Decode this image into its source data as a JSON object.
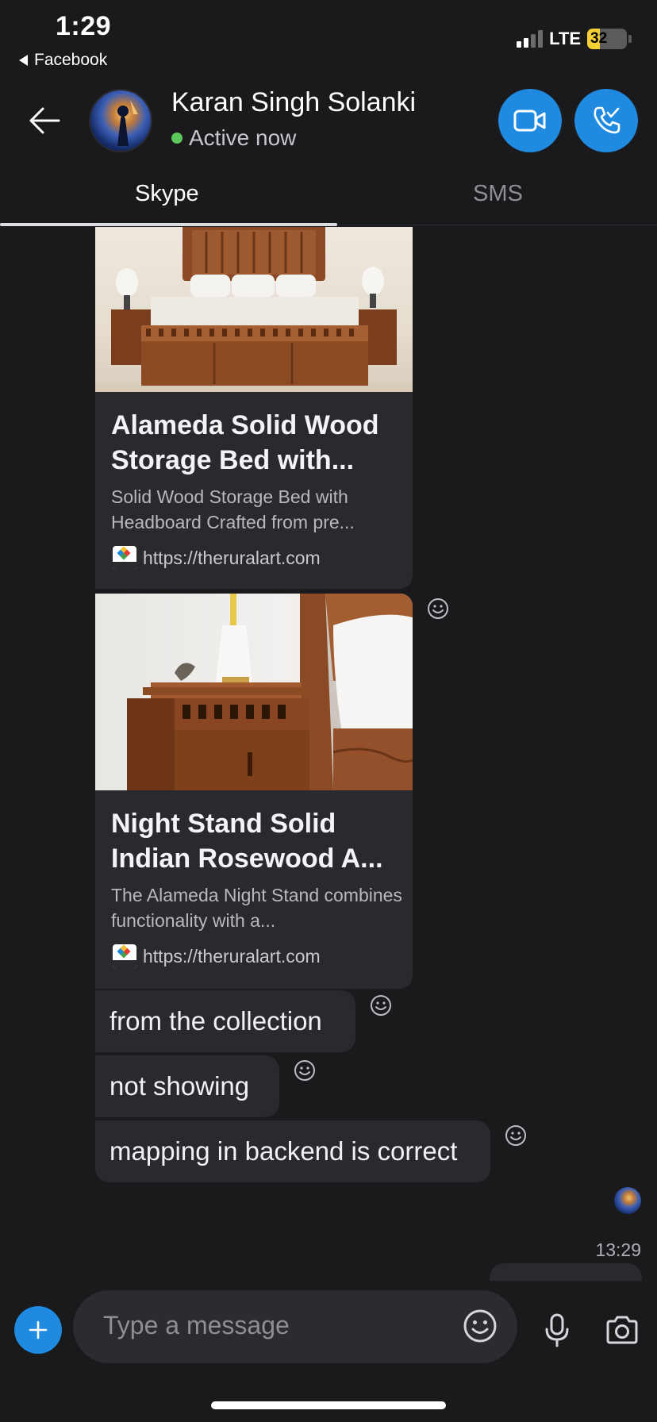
{
  "status_bar": {
    "time": "1:29",
    "back_app": "Facebook",
    "network": "LTE",
    "battery_percent": "32",
    "battery_level": 0.32
  },
  "header": {
    "contact_name": "Karan Singh Solanki",
    "presence": "Active now",
    "icons": {
      "back": "back-arrow-icon",
      "video_call": "video-camera-icon",
      "audio_call": "phone-call-icon"
    }
  },
  "tabs": [
    {
      "label": "Skype",
      "active": true
    },
    {
      "label": "SMS",
      "active": false
    }
  ],
  "messages": {
    "cards": [
      {
        "title": "Alameda Solid Wood Storage Bed with...",
        "description": "Solid Wood Storage Bed with Headboard Crafted from pre...",
        "url": "https://theruralart.com"
      },
      {
        "title": "Night Stand Solid Indian Rosewood A...",
        "description": "The Alameda Night Stand combines functionality with a...",
        "url": "https://theruralart.com"
      }
    ],
    "texts": [
      "from the collection",
      "not showing",
      "mapping in backend is correct"
    ],
    "timestamp": "13:29"
  },
  "composer": {
    "placeholder": "Type a message",
    "icons": {
      "add": "plus-icon",
      "emoji": "smiley-icon",
      "mic": "microphone-icon",
      "camera": "camera-icon"
    }
  },
  "colors": {
    "background": "#1a1a1c",
    "bubble": "#2a2a2e",
    "accent": "#1f8ae0",
    "online": "#5ac85a",
    "battery": "#f5d033"
  }
}
